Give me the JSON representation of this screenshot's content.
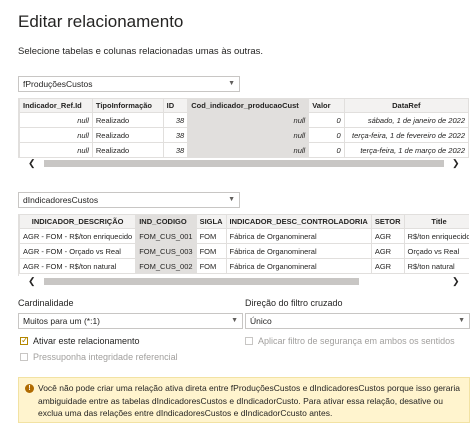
{
  "title": "Editar relacionamento",
  "subtitle": "Selecione tabelas e colunas relacionadas umas às outras.",
  "table1": {
    "dropdown_value": "fProduçõesCustos",
    "headers": [
      "Indicador_Ref.Id",
      "TipoInformação",
      "ID",
      "Cod_indicador_producaoCust",
      "Valor",
      "DataRef"
    ],
    "rows": [
      [
        "null",
        "Realizado",
        "38",
        "null",
        "0",
        "sábado, 1 de janeiro de 2022"
      ],
      [
        "null",
        "Realizado",
        "38",
        "null",
        "0",
        "terça-feira, 1 de fevereiro de 2022"
      ],
      [
        "null",
        "Realizado",
        "38",
        "null",
        "0",
        "terça-feira, 1 de março de 2022"
      ]
    ]
  },
  "table2": {
    "dropdown_value": "dIndicadoresCustos",
    "headers": [
      "INDICADOR_DESCRIÇÃO",
      "IND_CODIGO",
      "SIGLA",
      "INDICADOR_DESC_CONTROLADORIA",
      "SETOR",
      "Title"
    ],
    "rows": [
      [
        "AGR - FOM - R$/ton enriquecido",
        "FOM_CUS_001",
        "FOM",
        "Fábrica de Organomineral",
        "AGR",
        "R$/ton enriquecido"
      ],
      [
        "AGR - FOM - Orçado vs Real",
        "FOM_CUS_003",
        "FOM",
        "Fábrica de Organomineral",
        "AGR",
        "Orçado vs Real"
      ],
      [
        "AGR - FOM - R$/ton natural",
        "FOM_CUS_002",
        "FOM",
        "Fábrica de Organomineral",
        "AGR",
        "R$/ton natural"
      ]
    ]
  },
  "cardinality": {
    "label": "Cardinalidade",
    "value": "Muitos para um (*:1)"
  },
  "filter_direction": {
    "label": "Direção do filtro cruzado",
    "value": "Único"
  },
  "options": {
    "activate": "Ativar este relacionamento",
    "security_filter": "Aplicar filtro de segurança em ambos os sentidos",
    "ref_integrity": "Pressuponha integridade referencial"
  },
  "warning": {
    "icon": "!",
    "text": "Você não pode criar uma relação ativa direta entre fProduçõesCustos e dIndicadoresCustos porque isso geraria ambiguidade entre as tabelas dIndicadoresCustos e dIndicadorCusto. Para ativar essa relação, desative ou exclua uma das relações entre dIndicadoresCustos e dIndicadorCcusto antes."
  },
  "scroll": {
    "left": "❮",
    "right": "❯"
  },
  "icons": {
    "dropdown": "chevron-down-icon",
    "warning": "warning-icon"
  },
  "colors": {
    "warning_bg": "#fff4ce",
    "checkbox_accent": "#b38600",
    "header_bg": "#f3f2f1"
  }
}
